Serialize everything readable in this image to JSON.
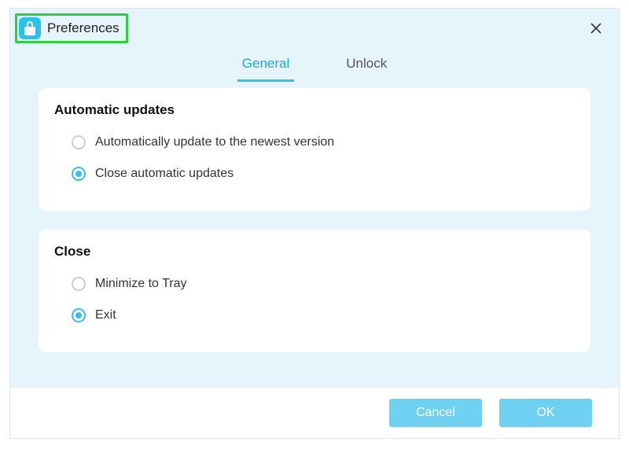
{
  "window": {
    "title": "Preferences"
  },
  "tabs": {
    "general": "General",
    "unlock": "Unlock",
    "active": "general"
  },
  "sections": {
    "updates": {
      "heading": "Automatic updates",
      "opt_auto": "Automatically update to the newest version",
      "opt_close": "Close automatic updates",
      "selected": "close"
    },
    "close": {
      "heading": "Close",
      "opt_tray": "Minimize to Tray",
      "opt_exit": "Exit",
      "selected": "exit"
    }
  },
  "buttons": {
    "cancel": "Cancel",
    "ok": "OK"
  },
  "colors": {
    "accent": "#35bfee",
    "window_bg": "#e6f5fb",
    "highlight_border": "#2ecc40"
  }
}
